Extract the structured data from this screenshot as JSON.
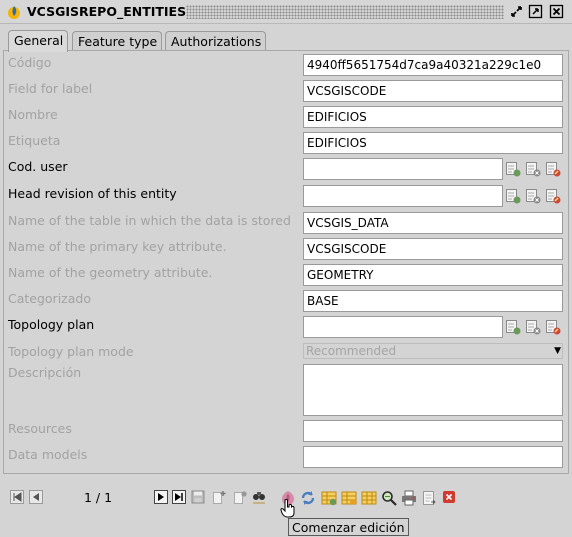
{
  "window": {
    "title": "VCSGISREPO_ENTITIES",
    "icon": "gvsig-logo-icon",
    "buttons": [
      "restore-icon",
      "maximize-icon",
      "close-icon"
    ]
  },
  "tabs": [
    {
      "label": "General",
      "active": true
    },
    {
      "label": "Feature type",
      "active": false
    },
    {
      "label": "Authorizations",
      "active": false
    }
  ],
  "fields": {
    "codigo": {
      "label": "Código",
      "value": "4940ff5651754d7ca9a40321a229c1e0"
    },
    "field_for_label": {
      "label": "Field for label",
      "value": "VCSGISCODE"
    },
    "nombre": {
      "label": "Nombre",
      "value": "EDIFICIOS"
    },
    "etiqueta": {
      "label": "Etiqueta",
      "value": "EDIFICIOS"
    },
    "cod_user": {
      "label": "Cod. user",
      "value": ""
    },
    "head_revision": {
      "label": "Head revision of this entity",
      "value": ""
    },
    "table_name": {
      "label": "Name of the table in which the data is stored",
      "value": "VCSGIS_DATA"
    },
    "pk_attribute": {
      "label": "Name of the primary key attribute.",
      "value": "VCSGISCODE"
    },
    "geometry_attribute": {
      "label": "Name of the geometry attribute.",
      "value": "GEOMETRY"
    },
    "categorizado": {
      "label": "Categorizado",
      "value": "BASE"
    },
    "topology_plan": {
      "label": "Topology plan",
      "value": ""
    },
    "topology_plan_mode": {
      "label": "Topology plan mode",
      "value": "Recommended"
    },
    "descripcion": {
      "label": "Descripción",
      "value": ""
    },
    "resources": {
      "label": "Resources",
      "value": ""
    },
    "data_models": {
      "label": "Data models",
      "value": ""
    }
  },
  "navigation": {
    "position": "1 / 1"
  },
  "tooltip": "Comenzar edición",
  "colors": {
    "background": "#d4d4d4",
    "disabled_text": "#a2a2a2",
    "add_icon": "#6a9a5a",
    "delete_icon": "#c94a3a",
    "toolbar_orange": "#e8a020",
    "toolbar_blue": "#4a7ec0"
  }
}
